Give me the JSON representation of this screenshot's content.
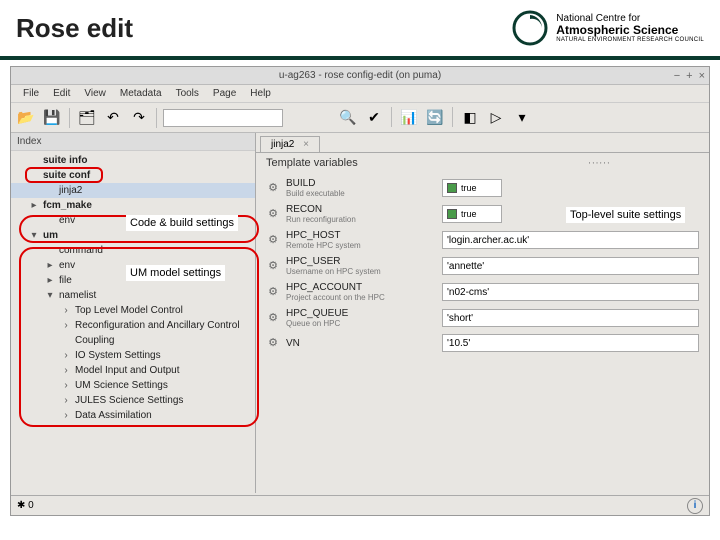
{
  "slide": {
    "title": "Rose edit",
    "logo_top": "National Centre for",
    "logo_mid": "Atmospheric Science",
    "logo_sub": "NATURAL ENVIRONMENT RESEARCH COUNCIL"
  },
  "window": {
    "title": "u-ag263 - rose config-edit (on puma)"
  },
  "menu": [
    "File",
    "Edit",
    "View",
    "Metadata",
    "Tools",
    "Page",
    "Help"
  ],
  "sidebar": {
    "head": "Index",
    "items": [
      {
        "lbl": "suite info",
        "bold": true,
        "ind": 1
      },
      {
        "lbl": "suite conf",
        "bold": true,
        "ind": 1,
        "highlight": true
      },
      {
        "lbl": "jinja2",
        "ind": 2,
        "sel": true
      },
      {
        "lbl": "fcm_make",
        "bold": true,
        "ind": 1,
        "arrow": "▸",
        "fcm": true
      },
      {
        "lbl": "env",
        "ind": 2
      },
      {
        "lbl": "um",
        "bold": true,
        "ind": 1,
        "arrow": "▾",
        "um": true
      },
      {
        "lbl": "command",
        "ind": 2
      },
      {
        "lbl": "env",
        "ind": 2,
        "arrow": "▸"
      },
      {
        "lbl": "file",
        "ind": 2,
        "arrow": "▸"
      },
      {
        "lbl": "namelist",
        "ind": 2,
        "arrow": "▾"
      },
      {
        "lbl": "Top Level Model Control",
        "ind": 3,
        "arrow": "›"
      },
      {
        "lbl": "Reconfiguration and Ancillary Control",
        "ind": 3,
        "arrow": "›"
      },
      {
        "lbl": "Coupling",
        "ind": 3
      },
      {
        "lbl": "IO System Settings",
        "ind": 3,
        "arrow": "›"
      },
      {
        "lbl": "Model Input and Output",
        "ind": 3,
        "arrow": "›"
      },
      {
        "lbl": "UM Science Settings",
        "ind": 3,
        "arrow": "›"
      },
      {
        "lbl": "JULES Science Settings",
        "ind": 3,
        "arrow": "›"
      },
      {
        "lbl": "Data Assimilation",
        "ind": 3,
        "arrow": "›"
      }
    ]
  },
  "main": {
    "tab": "jinja2",
    "panel_title": "Template variables",
    "rows": [
      {
        "name": "BUILD",
        "help": "Build executable",
        "type": "check",
        "val": "true"
      },
      {
        "name": "RECON",
        "help": "Run reconfiguration",
        "type": "check",
        "val": "true"
      },
      {
        "name": "HPC_HOST",
        "help": "Remote HPC system",
        "type": "text",
        "val": "'login.archer.ac.uk'"
      },
      {
        "name": "HPC_USER",
        "help": "Username on HPC system",
        "type": "text",
        "val": "'annette'"
      },
      {
        "name": "HPC_ACCOUNT",
        "help": "Project account on the HPC",
        "type": "text",
        "val": "'n02-cms'"
      },
      {
        "name": "HPC_QUEUE",
        "help": "Queue on HPC",
        "type": "text",
        "val": "'short'"
      },
      {
        "name": "VN",
        "help": "",
        "type": "text",
        "val": "'10.5'"
      }
    ]
  },
  "status": {
    "left": "0"
  },
  "annot": {
    "code_build": "Code & build settings",
    "um_model": "UM model settings",
    "top_level": "Top-level suite settings"
  }
}
